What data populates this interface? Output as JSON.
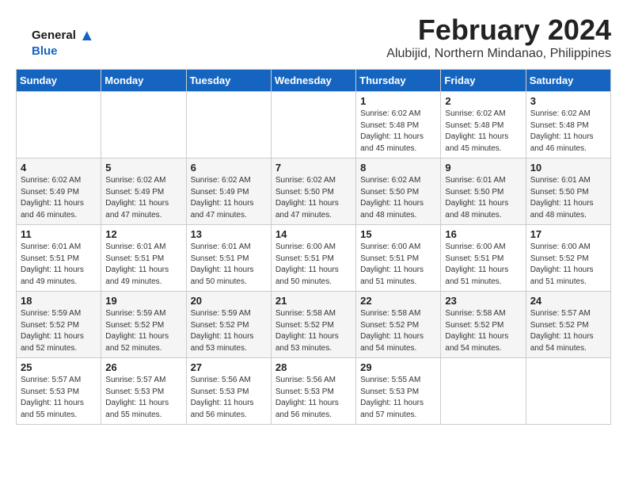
{
  "logo": {
    "line1": "General",
    "line2": "Blue"
  },
  "header": {
    "month_year": "February 2024",
    "location": "Alubijid, Northern Mindanao, Philippines"
  },
  "days_of_week": [
    "Sunday",
    "Monday",
    "Tuesday",
    "Wednesday",
    "Thursday",
    "Friday",
    "Saturday"
  ],
  "weeks": [
    [
      {
        "day": "",
        "info": ""
      },
      {
        "day": "",
        "info": ""
      },
      {
        "day": "",
        "info": ""
      },
      {
        "day": "",
        "info": ""
      },
      {
        "day": "1",
        "info": "Sunrise: 6:02 AM\nSunset: 5:48 PM\nDaylight: 11 hours\nand 45 minutes."
      },
      {
        "day": "2",
        "info": "Sunrise: 6:02 AM\nSunset: 5:48 PM\nDaylight: 11 hours\nand 45 minutes."
      },
      {
        "day": "3",
        "info": "Sunrise: 6:02 AM\nSunset: 5:48 PM\nDaylight: 11 hours\nand 46 minutes."
      }
    ],
    [
      {
        "day": "4",
        "info": "Sunrise: 6:02 AM\nSunset: 5:49 PM\nDaylight: 11 hours\nand 46 minutes."
      },
      {
        "day": "5",
        "info": "Sunrise: 6:02 AM\nSunset: 5:49 PM\nDaylight: 11 hours\nand 47 minutes."
      },
      {
        "day": "6",
        "info": "Sunrise: 6:02 AM\nSunset: 5:49 PM\nDaylight: 11 hours\nand 47 minutes."
      },
      {
        "day": "7",
        "info": "Sunrise: 6:02 AM\nSunset: 5:50 PM\nDaylight: 11 hours\nand 47 minutes."
      },
      {
        "day": "8",
        "info": "Sunrise: 6:02 AM\nSunset: 5:50 PM\nDaylight: 11 hours\nand 48 minutes."
      },
      {
        "day": "9",
        "info": "Sunrise: 6:01 AM\nSunset: 5:50 PM\nDaylight: 11 hours\nand 48 minutes."
      },
      {
        "day": "10",
        "info": "Sunrise: 6:01 AM\nSunset: 5:50 PM\nDaylight: 11 hours\nand 48 minutes."
      }
    ],
    [
      {
        "day": "11",
        "info": "Sunrise: 6:01 AM\nSunset: 5:51 PM\nDaylight: 11 hours\nand 49 minutes."
      },
      {
        "day": "12",
        "info": "Sunrise: 6:01 AM\nSunset: 5:51 PM\nDaylight: 11 hours\nand 49 minutes."
      },
      {
        "day": "13",
        "info": "Sunrise: 6:01 AM\nSunset: 5:51 PM\nDaylight: 11 hours\nand 50 minutes."
      },
      {
        "day": "14",
        "info": "Sunrise: 6:00 AM\nSunset: 5:51 PM\nDaylight: 11 hours\nand 50 minutes."
      },
      {
        "day": "15",
        "info": "Sunrise: 6:00 AM\nSunset: 5:51 PM\nDaylight: 11 hours\nand 51 minutes."
      },
      {
        "day": "16",
        "info": "Sunrise: 6:00 AM\nSunset: 5:51 PM\nDaylight: 11 hours\nand 51 minutes."
      },
      {
        "day": "17",
        "info": "Sunrise: 6:00 AM\nSunset: 5:52 PM\nDaylight: 11 hours\nand 51 minutes."
      }
    ],
    [
      {
        "day": "18",
        "info": "Sunrise: 5:59 AM\nSunset: 5:52 PM\nDaylight: 11 hours\nand 52 minutes."
      },
      {
        "day": "19",
        "info": "Sunrise: 5:59 AM\nSunset: 5:52 PM\nDaylight: 11 hours\nand 52 minutes."
      },
      {
        "day": "20",
        "info": "Sunrise: 5:59 AM\nSunset: 5:52 PM\nDaylight: 11 hours\nand 53 minutes."
      },
      {
        "day": "21",
        "info": "Sunrise: 5:58 AM\nSunset: 5:52 PM\nDaylight: 11 hours\nand 53 minutes."
      },
      {
        "day": "22",
        "info": "Sunrise: 5:58 AM\nSunset: 5:52 PM\nDaylight: 11 hours\nand 54 minutes."
      },
      {
        "day": "23",
        "info": "Sunrise: 5:58 AM\nSunset: 5:52 PM\nDaylight: 11 hours\nand 54 minutes."
      },
      {
        "day": "24",
        "info": "Sunrise: 5:57 AM\nSunset: 5:52 PM\nDaylight: 11 hours\nand 54 minutes."
      }
    ],
    [
      {
        "day": "25",
        "info": "Sunrise: 5:57 AM\nSunset: 5:53 PM\nDaylight: 11 hours\nand 55 minutes."
      },
      {
        "day": "26",
        "info": "Sunrise: 5:57 AM\nSunset: 5:53 PM\nDaylight: 11 hours\nand 55 minutes."
      },
      {
        "day": "27",
        "info": "Sunrise: 5:56 AM\nSunset: 5:53 PM\nDaylight: 11 hours\nand 56 minutes."
      },
      {
        "day": "28",
        "info": "Sunrise: 5:56 AM\nSunset: 5:53 PM\nDaylight: 11 hours\nand 56 minutes."
      },
      {
        "day": "29",
        "info": "Sunrise: 5:55 AM\nSunset: 5:53 PM\nDaylight: 11 hours\nand 57 minutes."
      },
      {
        "day": "",
        "info": ""
      },
      {
        "day": "",
        "info": ""
      }
    ]
  ]
}
